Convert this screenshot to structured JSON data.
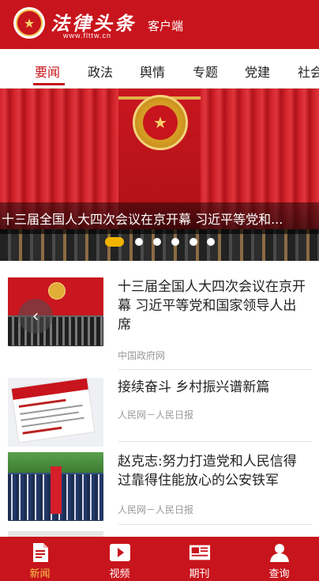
{
  "header": {
    "logo_text": "法律头条",
    "logo_url": "www.flttw.cn",
    "subtitle": "客户端",
    "brand_color": "#c8141c"
  },
  "tabs": [
    {
      "label": "要闻",
      "active": true
    },
    {
      "label": "政法",
      "active": false
    },
    {
      "label": "舆情",
      "active": false
    },
    {
      "label": "专题",
      "active": false
    },
    {
      "label": "党建",
      "active": false
    },
    {
      "label": "社会",
      "active": false
    }
  ],
  "banner": {
    "caption": "十三届全国人大四次会议在京开幕 习近平等党和...",
    "slide_count": 6,
    "active_slide": 1
  },
  "news": [
    {
      "title": "十三届全国人大四次会议在京开幕 习近平等党和国家领导人出席",
      "source": "中国政府网"
    },
    {
      "title": "接续奋斗 乡村振兴谱新篇",
      "source": "人民网－人民日报"
    },
    {
      "title": "赵克志:努力打造党和人民信得过靠得住能放心的公安铁军",
      "source": "人民网－人民日报"
    },
    {
      "title": "",
      "source": ""
    }
  ],
  "bottom_nav": [
    {
      "label": "新闻",
      "icon": "news-icon",
      "active": true
    },
    {
      "label": "视频",
      "icon": "video-play-icon",
      "active": false
    },
    {
      "label": "期刊",
      "icon": "journal-icon",
      "active": false
    },
    {
      "label": "查询",
      "icon": "user-search-icon",
      "active": false
    }
  ]
}
